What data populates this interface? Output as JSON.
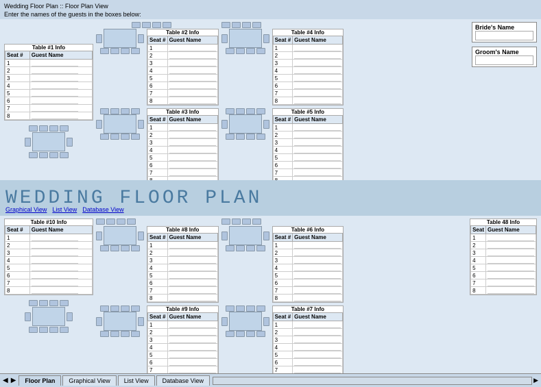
{
  "app": {
    "title": "Wedding Floor Plan :: Floor Plan View",
    "instruction": "Enter the names of the guests in the boxes below:"
  },
  "banner": {
    "title": "WEDDING FLOOR PLAN"
  },
  "nav": {
    "graphical": "Graphical View",
    "list": "List View",
    "database": "Database View"
  },
  "tabs": {
    "items": [
      "Floor Plan",
      "Graphical View",
      "List View",
      "Database View"
    ]
  },
  "bride": {
    "label": "Bride's Name",
    "value": ""
  },
  "groom": {
    "label": "Groom's Name",
    "value": ""
  },
  "tables": [
    {
      "id": 1,
      "label": "Table #1 Info",
      "col": "Seat #",
      "col2": "Guest Name",
      "seats": 8
    },
    {
      "id": 2,
      "label": "Table #2 Info",
      "col": "Seat #",
      "col2": "Guest Name",
      "seats": 8
    },
    {
      "id": 3,
      "label": "Table #3 Info",
      "col": "Seat #",
      "col2": "Guest Name",
      "seats": 8
    },
    {
      "id": 4,
      "label": "Table #4 Info",
      "col": "Seat #",
      "col2": "Guest Name",
      "seats": 8
    },
    {
      "id": 5,
      "label": "Table #5 Info",
      "col": "Seat #",
      "col2": "Guest Name",
      "seats": 8
    },
    {
      "id": 6,
      "label": "Table #6 Info",
      "col": "Seat #",
      "col2": "Guest Name",
      "seats": 8
    },
    {
      "id": 7,
      "label": "Table #7 Info",
      "col": "Seat #",
      "col2": "Guest Name",
      "seats": 8
    },
    {
      "id": 8,
      "label": "Table #8 Info",
      "col": "Seat #",
      "col2": "Guest Name",
      "seats": 8
    },
    {
      "id": 9,
      "label": "Table #9 Info",
      "col": "Seat #",
      "col2": "Guest Name",
      "seats": 8
    },
    {
      "id": 10,
      "label": "Table #10 Info",
      "col": "Seat #",
      "col2": "Guest Name",
      "seats": 8
    }
  ]
}
